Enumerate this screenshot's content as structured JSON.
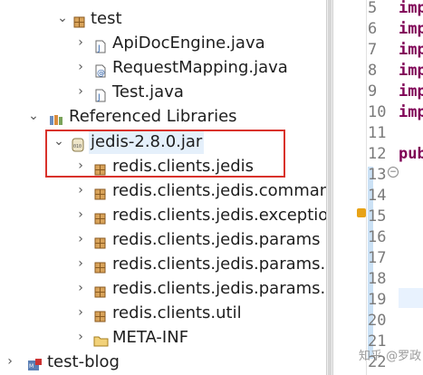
{
  "tree": {
    "rows": [
      {
        "label": "test",
        "chevron": "⌄",
        "icon": "package-icon"
      },
      {
        "label": "ApiDocEngine.java",
        "chevron": "›",
        "icon": "java-file-icon"
      },
      {
        "label": "RequestMapping.java",
        "chevron": "›",
        "icon": "java-file-icon"
      },
      {
        "label": "Test.java",
        "chevron": "›",
        "icon": "java-file-icon"
      },
      {
        "label": "Referenced Libraries",
        "chevron": "⌄",
        "icon": "library-icon"
      },
      {
        "label": "jedis-2.8.0.jar",
        "chevron": "⌄",
        "icon": "jar-icon"
      },
      {
        "label": "redis.clients.jedis",
        "chevron": "›",
        "icon": "package-icon"
      },
      {
        "label": "redis.clients.jedis.command",
        "chevron": "›",
        "icon": "package-icon"
      },
      {
        "label": "redis.clients.jedis.exception",
        "chevron": "›",
        "icon": "package-icon"
      },
      {
        "label": "redis.clients.jedis.params",
        "chevron": "›",
        "icon": "package-icon"
      },
      {
        "label": "redis.clients.jedis.params.ge",
        "chevron": "›",
        "icon": "package-icon"
      },
      {
        "label": "redis.clients.jedis.params.sc",
        "chevron": "›",
        "icon": "package-icon"
      },
      {
        "label": "redis.clients.util",
        "chevron": "›",
        "icon": "package-icon"
      },
      {
        "label": "META-INF",
        "chevron": "›",
        "icon": "folder-icon"
      },
      {
        "label": "test-blog",
        "chevron": "›",
        "icon": "project-icon"
      }
    ]
  },
  "editor": {
    "lines": [
      {
        "num": "5",
        "code": "imp"
      },
      {
        "num": "6",
        "code": "imp"
      },
      {
        "num": "7",
        "code": "imp"
      },
      {
        "num": "8",
        "code": "imp"
      },
      {
        "num": "9",
        "code": "imp"
      },
      {
        "num": "10",
        "code": "imp"
      },
      {
        "num": "11",
        "code": ""
      },
      {
        "num": "12",
        "code": "pub"
      },
      {
        "num": "13",
        "code": ""
      },
      {
        "num": "14",
        "code": ""
      },
      {
        "num": "15",
        "code": ""
      },
      {
        "num": "16",
        "code": ""
      },
      {
        "num": "17",
        "code": ""
      },
      {
        "num": "18",
        "code": ""
      },
      {
        "num": "19",
        "code": ""
      },
      {
        "num": "20",
        "code": ""
      },
      {
        "num": "21",
        "code": ""
      },
      {
        "num": "22",
        "code": ""
      }
    ]
  },
  "watermark": "知乎 @罗政",
  "colors": {
    "highlight_box": "#d9322b",
    "keyword": "#7f0055",
    "selection": "#e5f0fb"
  }
}
